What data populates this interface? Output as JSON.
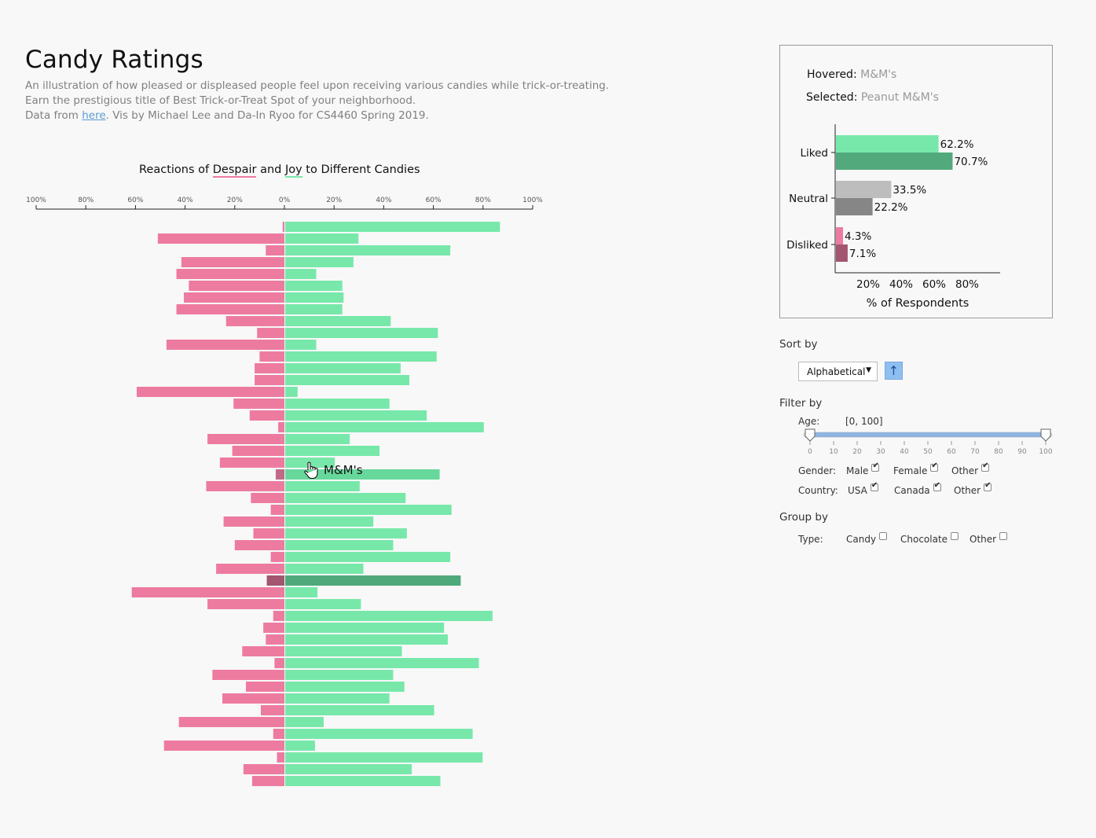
{
  "header": {
    "title": "Candy Ratings",
    "line1": "An illustration of how pleased or displeased people feel upon receiving various candies while trick-or-treating.",
    "line2": "Earn the prestigious title of Best Trick-or-Treat Spot of your neighborhood.",
    "line3_prefix": "Data from ",
    "line3_link": "here",
    "line3_suffix": ". Vis by Michael Lee and Da-In Ryoo for CS4460 Spring 2019."
  },
  "chart_data": [
    {
      "type": "bar",
      "title": "Reactions of Despair and Joy to Different Candies",
      "title_parts": [
        "Reactions of ",
        "Despair",
        " and ",
        "Joy",
        " to Different Candies"
      ],
      "x_ticks": [
        "100%",
        "80%",
        "60%",
        "40%",
        "20%",
        "0%",
        "20%",
        "40%",
        "60%",
        "80%",
        "100%"
      ],
      "xlim": [
        -100,
        100
      ],
      "series": [
        {
          "name": "Despair",
          "color": "#ed7ba0",
          "values": [
            0.7,
            51,
            7.5,
            41.5,
            43.5,
            38.5,
            40.5,
            43.5,
            23.5,
            11,
            47.5,
            10,
            12,
            12,
            59.5,
            20.5,
            14,
            2.5,
            31,
            21,
            26,
            3.5,
            31.5,
            13.5,
            5.5,
            24.5,
            12.5,
            20,
            5.5,
            27.5,
            7.1,
            61.5,
            31,
            4.5,
            8.5,
            7.5,
            17,
            4,
            29,
            15.5,
            25,
            9.5,
            42.5,
            4.5,
            48.5,
            3,
            16.5,
            13
          ]
        },
        {
          "name": "Joy",
          "color": "#77e8aa",
          "values": [
            86.5,
            29.5,
            66.5,
            27.5,
            12.5,
            23,
            23.5,
            23,
            42.5,
            61.5,
            12.5,
            61,
            46.5,
            50,
            5,
            42,
            57,
            80,
            26,
            38,
            20,
            62.2,
            30,
            48.5,
            67,
            35.5,
            49,
            43.5,
            66.5,
            31.5,
            70.7,
            13,
            30.5,
            83.5,
            64,
            65.5,
            47,
            78,
            43.5,
            48,
            42,
            60,
            15.5,
            75.5,
            12,
            79.5,
            51,
            62.5
          ]
        }
      ],
      "hovered_index": 21,
      "selected_index": 30,
      "hover_label": "M&M's"
    },
    {
      "type": "bar",
      "orientation": "horizontal",
      "categories": [
        "Liked",
        "Neutral",
        "Disliked"
      ],
      "series": [
        {
          "name": "M&M's",
          "role": "hovered",
          "values": [
            62.2,
            33.5,
            4.3
          ]
        },
        {
          "name": "Peanut M&M's",
          "role": "selected",
          "values": [
            70.7,
            22.2,
            7.1
          ]
        }
      ],
      "value_labels": [
        [
          "62.2%",
          "33.5%",
          "4.3%"
        ],
        [
          "70.7%",
          "22.2%",
          "7.1%"
        ]
      ],
      "x_ticks": [
        "20%",
        "40%",
        "60%",
        "80%"
      ],
      "xlim": [
        0,
        100
      ],
      "xlabel": "% of Respondents"
    }
  ],
  "detail": {
    "hovered_label": "Hovered:",
    "hovered_value": "M&M's",
    "selected_label": "Selected:",
    "selected_value": "Peanut M&M's"
  },
  "controls": {
    "sort_label": "Sort by",
    "sort_value": "Alphabetical",
    "sort_dir_icon": "arrow-up",
    "filter_label": "Filter by",
    "age_label": "Age:",
    "age_range_text": "[0, 100]",
    "age_range": [
      0,
      100
    ],
    "age_ticks": [
      "0",
      "10",
      "20",
      "30",
      "40",
      "50",
      "60",
      "70",
      "80",
      "90",
      "100"
    ],
    "gender_label": "Gender:",
    "gender": [
      {
        "label": "Male",
        "checked": true
      },
      {
        "label": "Female",
        "checked": true
      },
      {
        "label": "Other",
        "checked": true
      }
    ],
    "country_label": "Country:",
    "country": [
      {
        "label": "USA",
        "checked": true
      },
      {
        "label": "Canada",
        "checked": true
      },
      {
        "label": "Other",
        "checked": true
      }
    ],
    "group_label": "Group by",
    "type_label": "Type:",
    "type": [
      {
        "label": "Candy",
        "checked": false
      },
      {
        "label": "Chocolate",
        "checked": false
      },
      {
        "label": "Other",
        "checked": false
      }
    ]
  }
}
